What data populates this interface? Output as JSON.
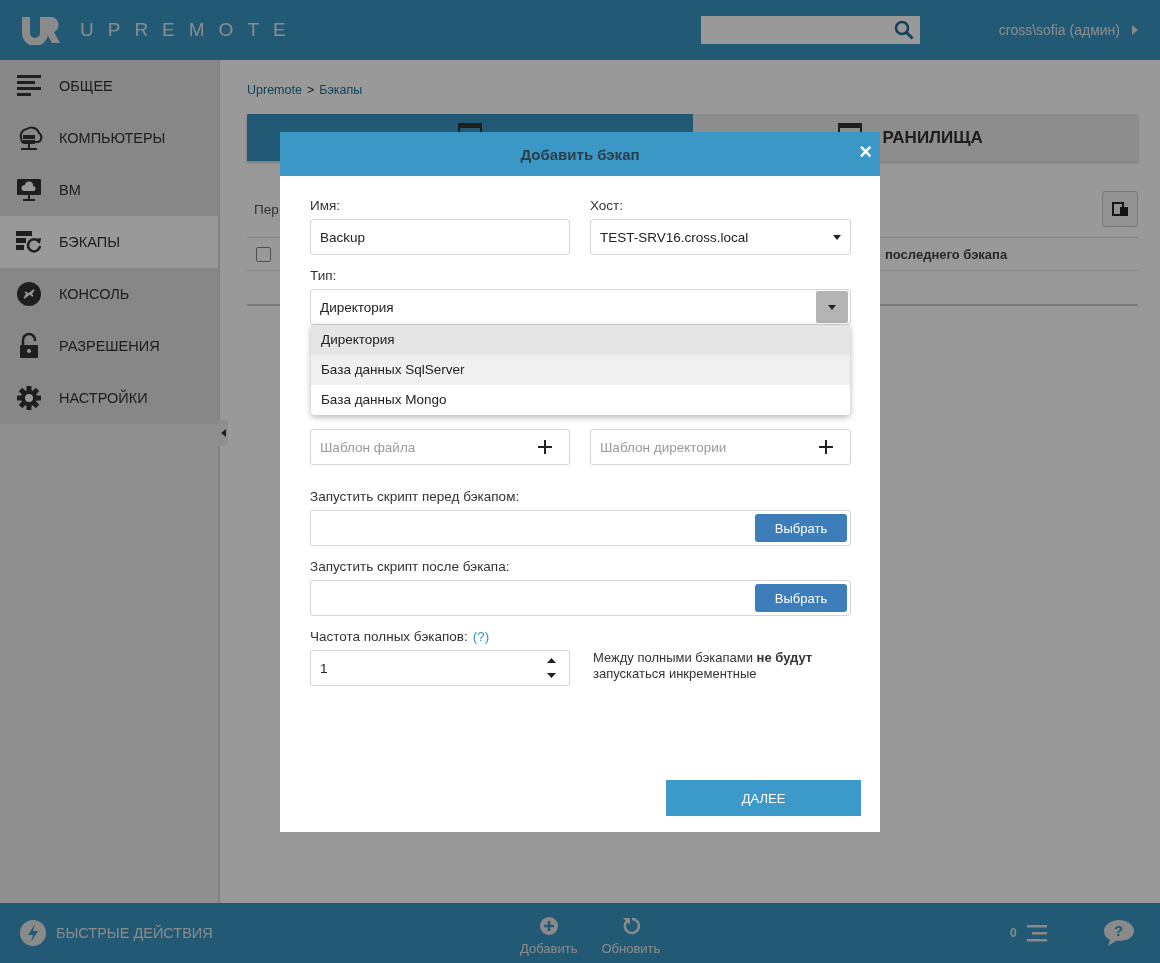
{
  "header": {
    "logo_text": "UPREMOTE",
    "user": "cross\\sofia (админ)"
  },
  "sidebar": {
    "items": [
      {
        "label": "ОБЩЕЕ",
        "selected": false
      },
      {
        "label": "КОМПЬЮТЕРЫ",
        "selected": false
      },
      {
        "label": "ВМ",
        "selected": false
      },
      {
        "label": "БЭКАПЫ",
        "selected": true
      },
      {
        "label": "КОНСОЛЬ",
        "selected": false
      },
      {
        "label": "РАЗРЕШЕНИЯ",
        "selected": false
      },
      {
        "label": "НАСТРОЙКИ",
        "selected": false
      }
    ]
  },
  "breadcrumb": {
    "items": [
      "Upremote",
      "Бэкапы"
    ],
    "separator": ">"
  },
  "tabs": [
    {
      "selected": true
    },
    {
      "label": "РАНИЛИЩА",
      "selected": false
    }
  ],
  "toolbar": {
    "label": "Пер"
  },
  "table": {
    "columns": [
      {
        "label": "последнего бэкапа"
      }
    ],
    "select_all": {
      "checked": false
    }
  },
  "modal": {
    "title": "Добавить бэкап",
    "close": "×",
    "name": {
      "label": "Имя:",
      "value": "Backup"
    },
    "host": {
      "label": "Хост:",
      "value": "TEST-SRV16.cross.local"
    },
    "type": {
      "label": "Тип:",
      "value": "Директория",
      "expanded": true,
      "options": [
        {
          "label": "Директория",
          "selected": true,
          "hovered": false
        },
        {
          "label": "База данных SqlServer",
          "selected": false,
          "hovered": true
        },
        {
          "label": "База данных Mongo",
          "selected": false,
          "hovered": false
        }
      ]
    },
    "exclude_files": {
      "placeholder": "Шаблон файла"
    },
    "exclude_dirs": {
      "placeholder": "Шаблон директории"
    },
    "script_before": {
      "label": "Запустить скрипт перед бэкапом:",
      "button": "Выбрать"
    },
    "script_after": {
      "label": "Запустить скрипт после бэкапа:",
      "button": "Выбрать"
    },
    "frequency": {
      "label": "Частота полных бэкапов:",
      "help": "(?)",
      "value": "1",
      "note": "Между полными бэкапами **не будут** запускаться инкрементные"
    },
    "next": "ДАЛЕЕ"
  },
  "footer": {
    "quick_actions": "БЫСТРЫЕ ДЕЙСТВИЯ",
    "actions": [
      {
        "label": "Добавить"
      },
      {
        "label": "Обновить"
      }
    ],
    "count": "0",
    "help": "?"
  }
}
